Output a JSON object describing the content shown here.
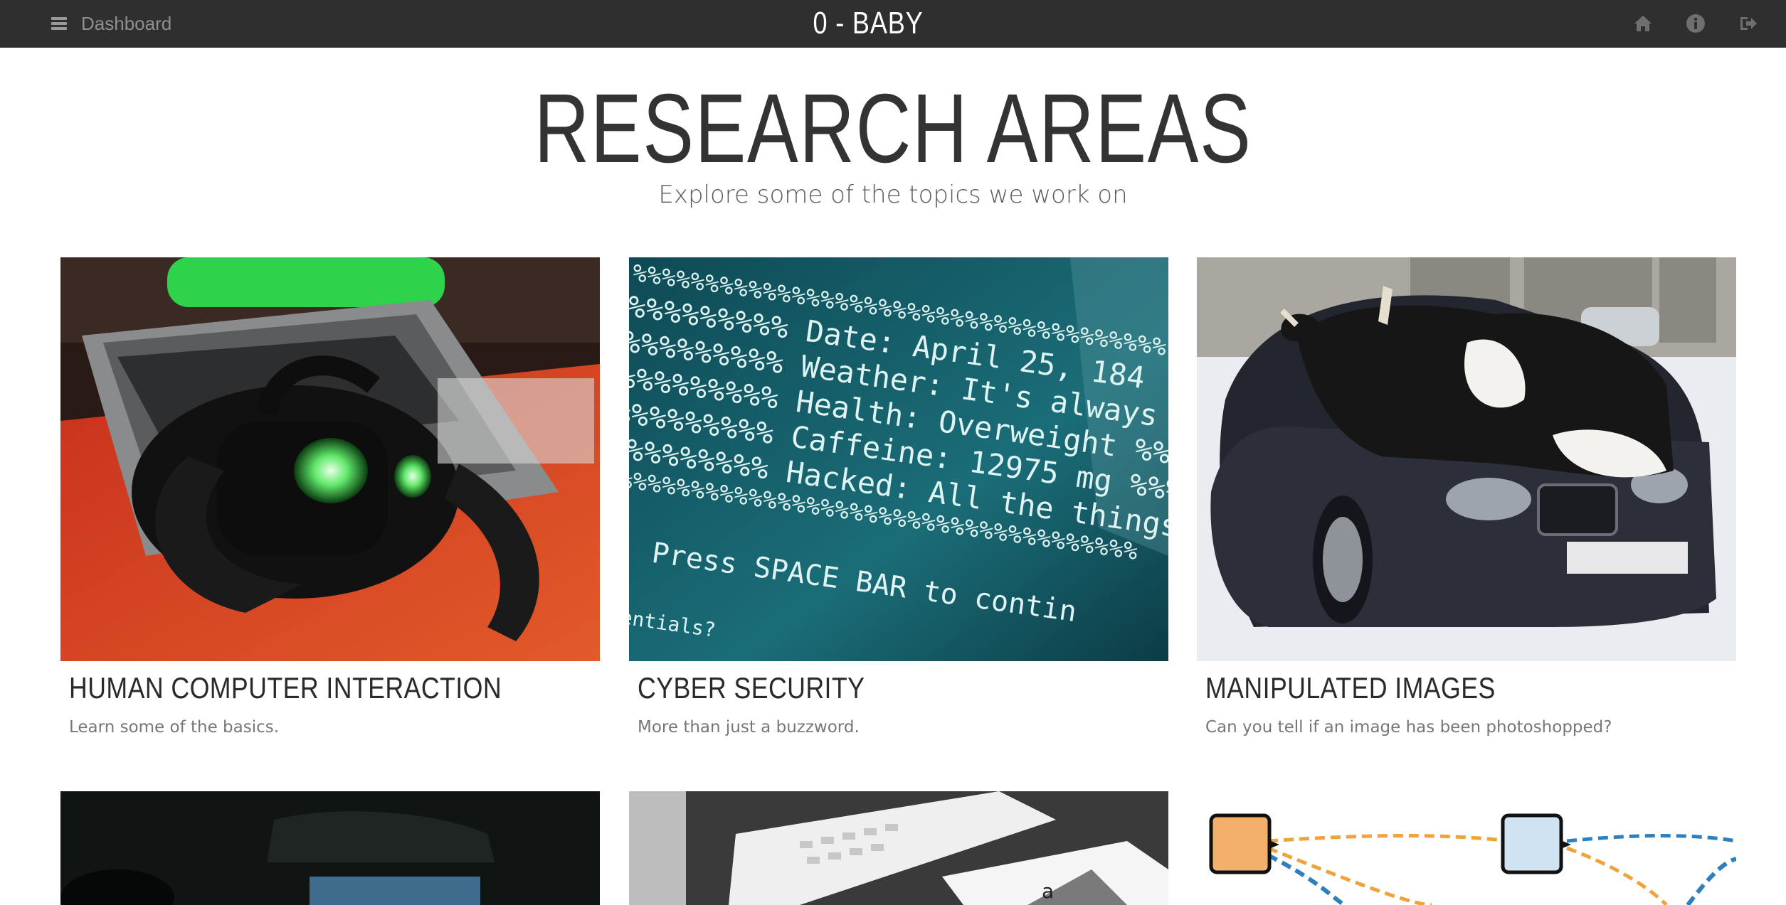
{
  "navbar": {
    "menu_label": "Dashboard",
    "brand": "0 - BABY",
    "icons": [
      "home-icon",
      "info-icon",
      "sign-out-icon"
    ]
  },
  "header": {
    "title": "RESEARCH AREAS",
    "subtitle": "Explore some of the topics we work on"
  },
  "cards": [
    {
      "title": "HUMAN COMPUTER INTERACTION",
      "description": "Learn some of the basics."
    },
    {
      "title": "CYBER SECURITY",
      "description": "More than just a buzzword."
    },
    {
      "title": "MANIPULATED IMAGES",
      "description": "Can you tell if an image has been photoshopped?"
    }
  ],
  "terminal": {
    "lines": [
      "%%%%%%%%% Date: April 25, 184",
      "%%%%%%%%% Weather: It's always c",
      "%%%%%%%%% Health: Overweight %%",
      "%%%%%%%%% Caffeine: 12975 mg %%%%",
      "%%%%%%%%% Hacked: All the things",
      "Press SPACE BAR to contin",
      "redentials?"
    ],
    "header_row": "%%%%%%%%%%%%%%%%%%%%%%%%%%%%%%%%%%%%%"
  },
  "colors": {
    "navbar_bg": "#2f2f2f",
    "title_text": "#333333",
    "subtitle_text": "#5a5a5a"
  }
}
